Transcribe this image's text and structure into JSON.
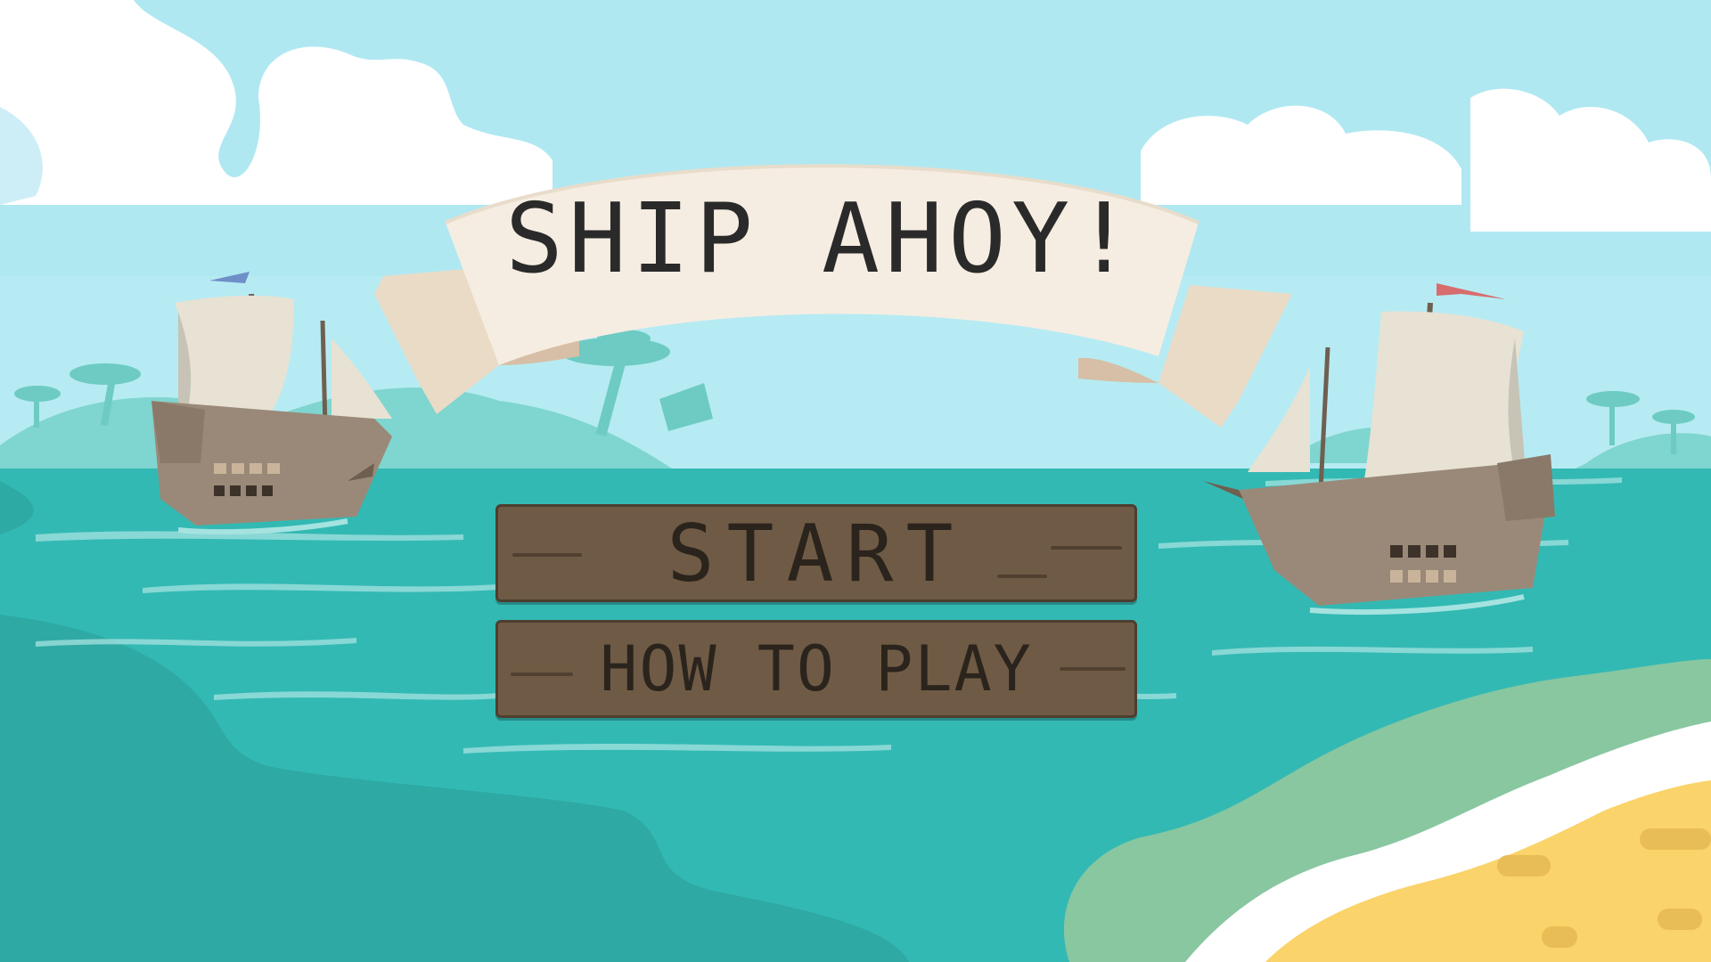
{
  "game": {
    "title": "SHIP AHOY!",
    "menu": {
      "start_label": "START",
      "how_to_play_label": "HOW TO PLAY"
    }
  },
  "colors": {
    "sky": "#b0e8f2",
    "sea": "#33b9b4",
    "sea_dark": "#2a9c96",
    "sand": "#fad36a",
    "banner": "#f6ede2",
    "wood": "#6f5b45"
  }
}
